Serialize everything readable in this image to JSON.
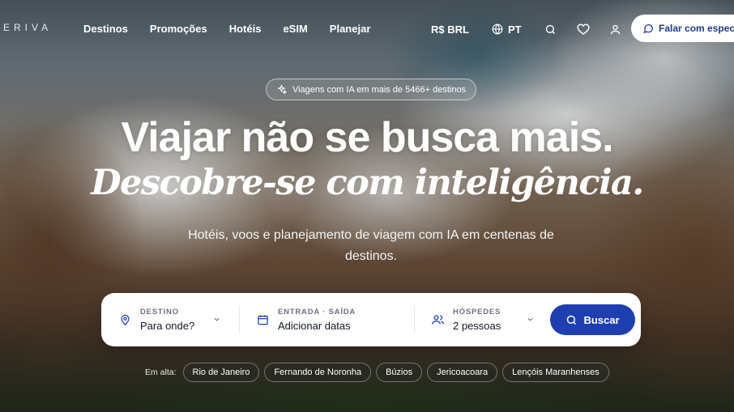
{
  "brand": {
    "logo_text": "ERIVA"
  },
  "nav": {
    "links": [
      "Destinos",
      "Promoções",
      "Hotéis",
      "eSIM",
      "Planejar"
    ],
    "currency": "R$ BRL",
    "language": "PT",
    "cta_label": "Falar com espec"
  },
  "hero": {
    "badge": "Viagens com IA em mais de 5466+ destinos",
    "title": "Viajar não se busca mais.",
    "subtitle": "Descobre-se com inteligência.",
    "description": "Hotéis, voos e planejamento de viagem com IA em centenas de destinos."
  },
  "search": {
    "destination": {
      "label": "DESTINO",
      "value": "Para onde?"
    },
    "dates": {
      "label": "ENTRADA · SAÍDA",
      "value": "Adicionar datas"
    },
    "guests": {
      "label": "HÓSPEDES",
      "value": "2 pessoas"
    },
    "button_label": "Buscar"
  },
  "trending": {
    "label": "Em alta:",
    "items": [
      "Rio de Janeiro",
      "Fernando de Noronha",
      "Búzios",
      "Jericoacoara",
      "Lençóis Maranhenses"
    ]
  },
  "colors": {
    "accent": "#1f3fb0",
    "cta_text": "#1f3a8a"
  }
}
